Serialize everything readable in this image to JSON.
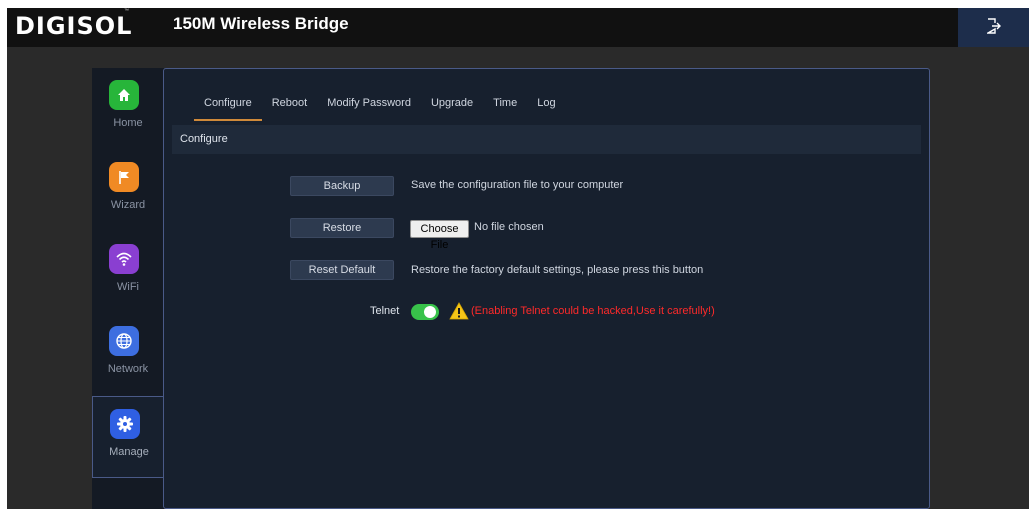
{
  "header": {
    "logo": "DIGISOL",
    "logo_mark": "™",
    "title": "150M Wireless Bridge",
    "logout_icon": "logout-icon"
  },
  "sidebar": {
    "items": [
      {
        "label": "Home",
        "icon": "home-icon",
        "color": "#27b53a"
      },
      {
        "label": "Wizard",
        "icon": "flag-icon",
        "color": "#f08a24"
      },
      {
        "label": "WiFi",
        "icon": "wifi-icon",
        "color": "#8a3fd1"
      },
      {
        "label": "Network",
        "icon": "globe-icon",
        "color": "#3d6ee0"
      },
      {
        "label": "Manage",
        "icon": "gear-icon",
        "color": "#2f5fe3",
        "active": true
      }
    ]
  },
  "tabs": [
    {
      "label": "Configure",
      "active": true
    },
    {
      "label": "Reboot"
    },
    {
      "label": "Modify Password"
    },
    {
      "label": "Upgrade"
    },
    {
      "label": "Time"
    },
    {
      "label": "Log"
    }
  ],
  "section": {
    "title": "Configure"
  },
  "actions": {
    "backup": {
      "button": "Backup",
      "description": "Save the configuration file to your computer"
    },
    "restore": {
      "button": "Restore",
      "file_button": "Choose File",
      "file_status": "No file chosen"
    },
    "reset": {
      "button": "Reset Default",
      "description": "Restore the factory default settings, please press this button"
    }
  },
  "telnet": {
    "label": "Telnet",
    "enabled": true,
    "warning": "(Enabling Telnet could be hacked,Use it carefully!)",
    "toggle_color": "#38c24a",
    "warning_color": "#ff2a2a"
  },
  "colors": {
    "accent_tab": "#d08a3a",
    "panel_border": "#4a5a88"
  }
}
